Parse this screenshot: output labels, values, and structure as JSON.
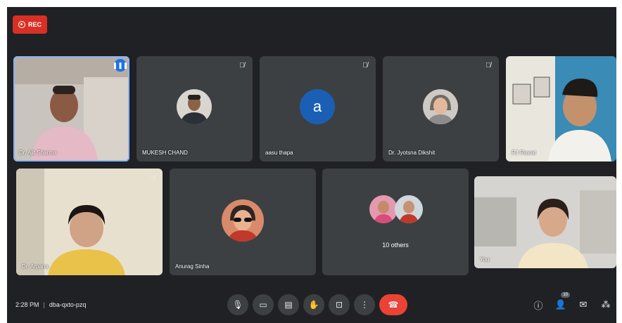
{
  "recording": {
    "label": "REC"
  },
  "tiles": [
    {
      "name": "Dr. Ajit Sharma",
      "type": "video"
    },
    {
      "name": "MUKESH CHAND",
      "type": "avatar"
    },
    {
      "name": "aasu thapa",
      "type": "letter",
      "letter": "a"
    },
    {
      "name": "Dr. Jyotsna Dikshit",
      "type": "avatar"
    },
    {
      "name": "RJ Rawat",
      "type": "video"
    },
    {
      "name": "Dr. Arpana",
      "type": "video"
    },
    {
      "name": "Anurag Sinha",
      "type": "avatar"
    },
    {
      "name": "10 others",
      "type": "group"
    },
    {
      "name": "You",
      "type": "video"
    }
  ],
  "meeting": {
    "time": "2:28 PM",
    "separator": "|",
    "code": "dba-qxto-pzq"
  },
  "participants_badge": "10",
  "colors": {
    "background": "#202124",
    "tile": "#3c4043",
    "end_call": "#ea4335",
    "rec": "#d93025",
    "speaking": "#8ab4f8"
  }
}
